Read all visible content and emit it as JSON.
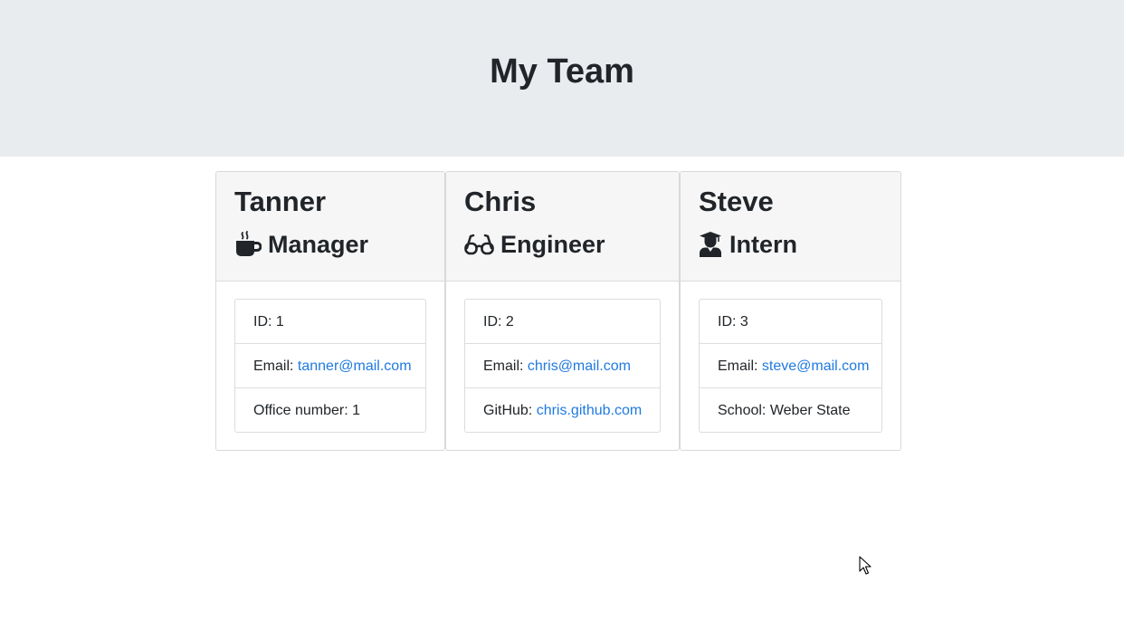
{
  "header": {
    "title": "My Team"
  },
  "cards": [
    {
      "name": "Tanner",
      "role": "Manager",
      "role_icon": "coffee-icon",
      "id_label": "ID:",
      "id_value": "1",
      "email_label": "Email:",
      "email": "tanner@mail.com",
      "extra_label": "Office number:",
      "extra_value": "1"
    },
    {
      "name": "Chris",
      "role": "Engineer",
      "role_icon": "glasses-icon",
      "id_label": "ID:",
      "id_value": "2",
      "email_label": "Email:",
      "email": "chris@mail.com",
      "extra_label": "GitHub:",
      "extra_value": "chris.github.com"
    },
    {
      "name": "Steve",
      "role": "Intern",
      "role_icon": "graduate-icon",
      "id_label": "ID:",
      "id_value": "3",
      "email_label": "Email:",
      "email": "steve@mail.com",
      "extra_label": "School:",
      "extra_value": "Weber State"
    }
  ],
  "colors": {
    "header_bg": "#e9ecef",
    "card_header_bg": "#f6f6f6",
    "link": "#1f7ae0",
    "text": "#212529"
  }
}
